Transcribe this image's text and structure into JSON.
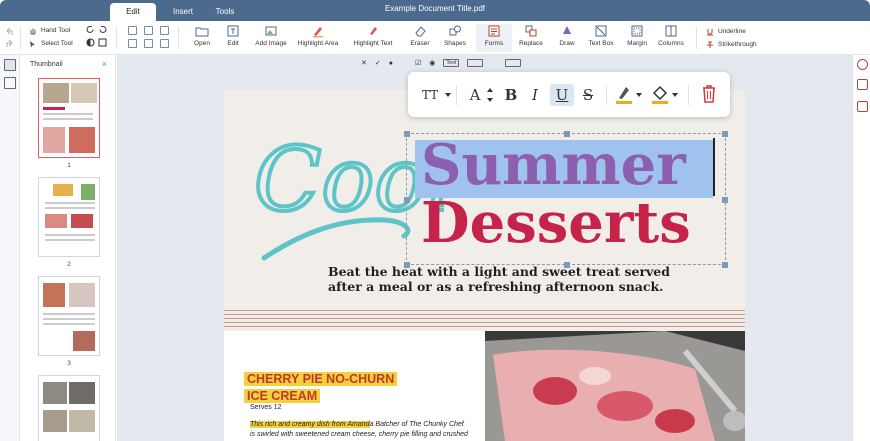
{
  "window": {
    "title": "Example Document Title.pdf"
  },
  "tabs": [
    {
      "label": "Edit",
      "active": true
    },
    {
      "label": "Insert",
      "active": false
    },
    {
      "label": "Tools",
      "active": false
    }
  ],
  "ribbon": {
    "hand_tool": "Hand Tool",
    "select_tool": "Select Tool",
    "buttons": [
      {
        "label": "Open",
        "icon": "folder-open-icon"
      },
      {
        "label": "Edit",
        "icon": "edit-text-icon"
      },
      {
        "label": "Add Image",
        "icon": "add-image-icon"
      },
      {
        "label": "Highlight Area",
        "icon": "highlight-area-icon"
      },
      {
        "label": "Highlight Text",
        "icon": "highlight-text-icon"
      },
      {
        "label": "Eraser",
        "icon": "eraser-icon"
      },
      {
        "label": "Shapes",
        "icon": "shapes-icon"
      },
      {
        "label": "Forms",
        "icon": "forms-icon",
        "active": true
      },
      {
        "label": "Replace",
        "icon": "replace-icon"
      },
      {
        "label": "Draw",
        "icon": "draw-icon"
      },
      {
        "label": "Text Box",
        "icon": "text-box-icon"
      },
      {
        "label": "Margin",
        "icon": "margin-icon"
      },
      {
        "label": "Columns",
        "icon": "columns-icon"
      }
    ],
    "underline": "Underline",
    "strikethrough": "Strikethrough"
  },
  "thumbnails": {
    "title": "Thumbnail",
    "pages": [
      "1",
      "2",
      "3"
    ],
    "selected_page": "1"
  },
  "form_toolbar": {
    "text_field": "Text",
    "icons": [
      "close-icon",
      "check-icon",
      "dot-icon",
      "checkbox-icon",
      "radio-icon",
      "text-field-icon",
      "list-box-icon",
      "signature-icon"
    ]
  },
  "floating_toolbar": {
    "font_size": "TT",
    "font_adjust": "A",
    "bold": "B",
    "italic": "I",
    "underline": "U",
    "strike": "S",
    "colors": {
      "text_highlight": "#f4a81d",
      "fill": "#f4a81d",
      "delete": "#d9363e"
    }
  },
  "document": {
    "script_title": "Cool",
    "headline_line1": "Summer",
    "headline_line2": "Desserts",
    "subtitle_line1": "Beat the heat with a light and sweet treat served",
    "subtitle_line2": "after a meal or as a refreshing afternoon snack.",
    "recipe_title_line1": "CHERRY PIE NO-CHURN",
    "recipe_title_line2": "ICE CREAM",
    "serves": "Serves 12",
    "desc_part1": "This rich and creamy dish from Amand",
    "desc_part2": "a Batcher of The Chunky Chef",
    "desc_line2": "is swirled with sweetened cream cheese, cherry pie filling and crushed",
    "colors": {
      "script": "#5ec4c8",
      "headline1": "#8c5fb0",
      "headline2": "#c6234a",
      "selection": "#9fc3ee",
      "accent": "#f4d03f"
    }
  }
}
